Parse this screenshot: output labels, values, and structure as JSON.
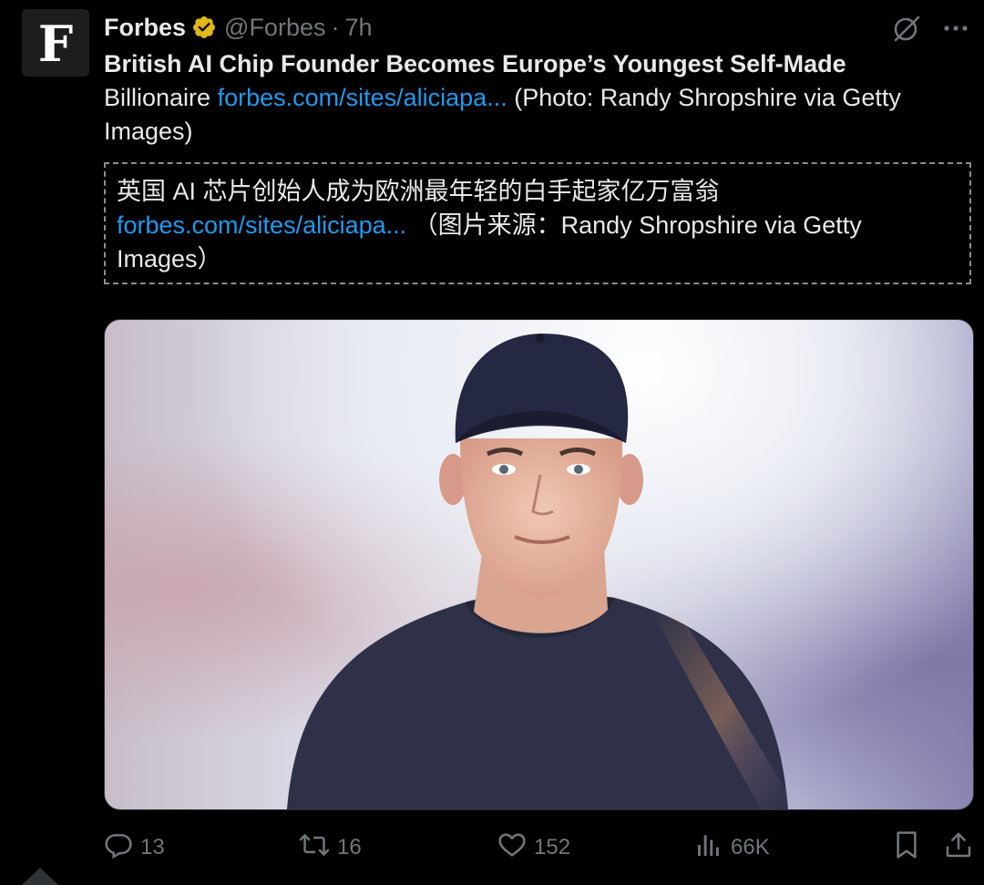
{
  "account": {
    "avatar_letter": "F",
    "display_name": "Forbes",
    "handle": "@Forbes",
    "separator": "·",
    "time": "7h",
    "verified_badge_color": "#e2b719"
  },
  "header_actions": {
    "grok_icon": "grok-icon",
    "more_icon": "more-horizontal-icon"
  },
  "tweet": {
    "headline": "British AI Chip Founder Becomes Europe’s Youngest Self-Made",
    "text_1": "Billionaire ",
    "link": "forbes.com/sites/aliciapa...",
    "text_2": " (Photo: Randy Shropshire via Getty Images)"
  },
  "translation": {
    "text_1": "英国 AI 芯片创始人成为欧洲最年轻的白手起家亿万富翁",
    "link": "forbes.com/sites/aliciapa...",
    "text_2": " （图片来源：Randy Shropshire via Getty Images）"
  },
  "media": {
    "description_icon": "photo"
  },
  "actions": {
    "replies": "13",
    "reposts": "16",
    "likes": "152",
    "views": "66K"
  },
  "colors": {
    "background": "#000000",
    "text": "#e7e9ea",
    "muted": "#71767b",
    "link": "#1d9bf0"
  }
}
